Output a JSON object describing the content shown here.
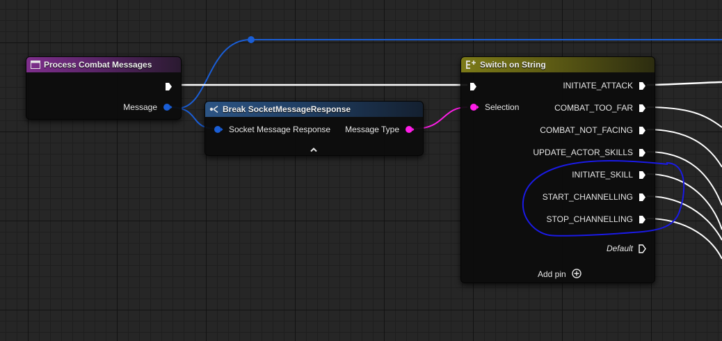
{
  "nodes": {
    "process_combat_messages": {
      "title": "Process Combat Messages",
      "message_pin": "Message"
    },
    "break_socket_message_response": {
      "title": "Break SocketMessageResponse",
      "input_pin": "Socket Message Response",
      "output_pin": "Message Type"
    },
    "switch_on_string": {
      "title": "Switch on String",
      "selection_pin": "Selection",
      "cases": [
        "INITIATE_ATTACK",
        "COMBAT_TOO_FAR",
        "COMBAT_NOT_FACING",
        "UPDATE_ACTOR_SKILLS",
        "INITIATE_SKILL",
        "START_CHANNELLING",
        "STOP_CHANNELLING"
      ],
      "default_pin": "Default",
      "add_pin": "Add pin"
    }
  },
  "colors": {
    "exec": "#ffffff",
    "struct_pin": "#1a5ed6",
    "string_pin": "#ff1ee8",
    "annotation": "#1a1ae6",
    "event_header": "#7e2e8c",
    "break_header": "#2c5484",
    "switch_header": "#7c7a18"
  }
}
